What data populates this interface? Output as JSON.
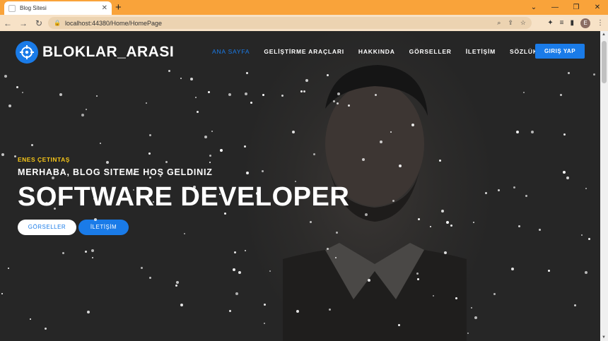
{
  "browser": {
    "tab_title": "Blog Sitesi",
    "new_tab": "+",
    "url": "localhost:44380/Home/HomePage",
    "profile_initial": "E"
  },
  "site": {
    "logo_text": "BLOKLAR_ARASI",
    "nav": [
      {
        "label": "ANA SAYFA",
        "active": true
      },
      {
        "label": "GELİŞTİRME ARAÇLARI",
        "active": false
      },
      {
        "label": "HAKKINDA",
        "active": false
      },
      {
        "label": "GÖRSELLER",
        "active": false
      },
      {
        "label": "İLETİŞİM",
        "active": false
      },
      {
        "label": "SÖZLÜK",
        "active": false
      }
    ],
    "login_label": "GIRIŞ YAP"
  },
  "hero": {
    "name": "ENES ÇETINTAŞ",
    "subtitle": "MERHABA, BLOG SITEME HOŞ GELDINIZ",
    "title": "SOFTWARE DEVELOPER",
    "btn_gallery": "GÖRSELLER",
    "btn_contact": "İLETİŞİM"
  },
  "colors": {
    "accent": "#1a7be8",
    "name_yellow": "#f5c518",
    "tabbar": "#f9a33a"
  }
}
